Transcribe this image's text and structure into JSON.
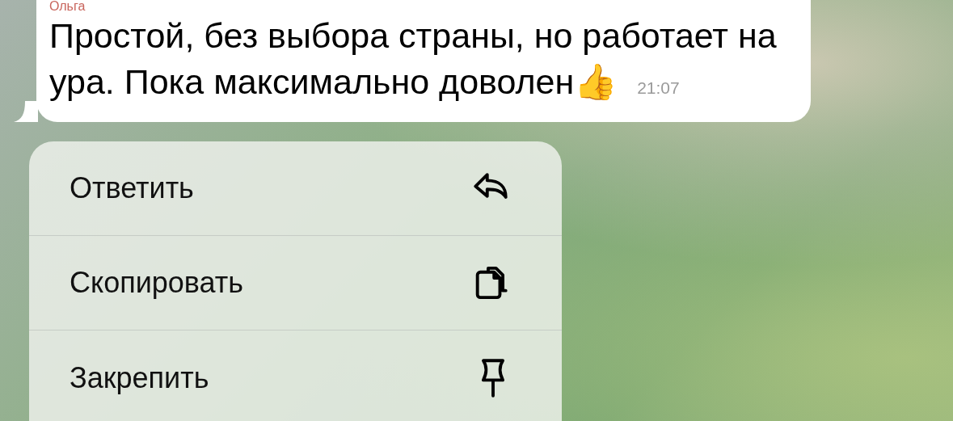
{
  "message": {
    "sender": "Ольга",
    "text": "Простой, без выбора страны, но работает на ура. Пока максимально доволен👍",
    "time": "21:07"
  },
  "menu": [
    {
      "kind": "reply",
      "label": "Ответить"
    },
    {
      "kind": "copy",
      "label": "Скопировать"
    },
    {
      "kind": "pin",
      "label": "Закрепить"
    }
  ]
}
